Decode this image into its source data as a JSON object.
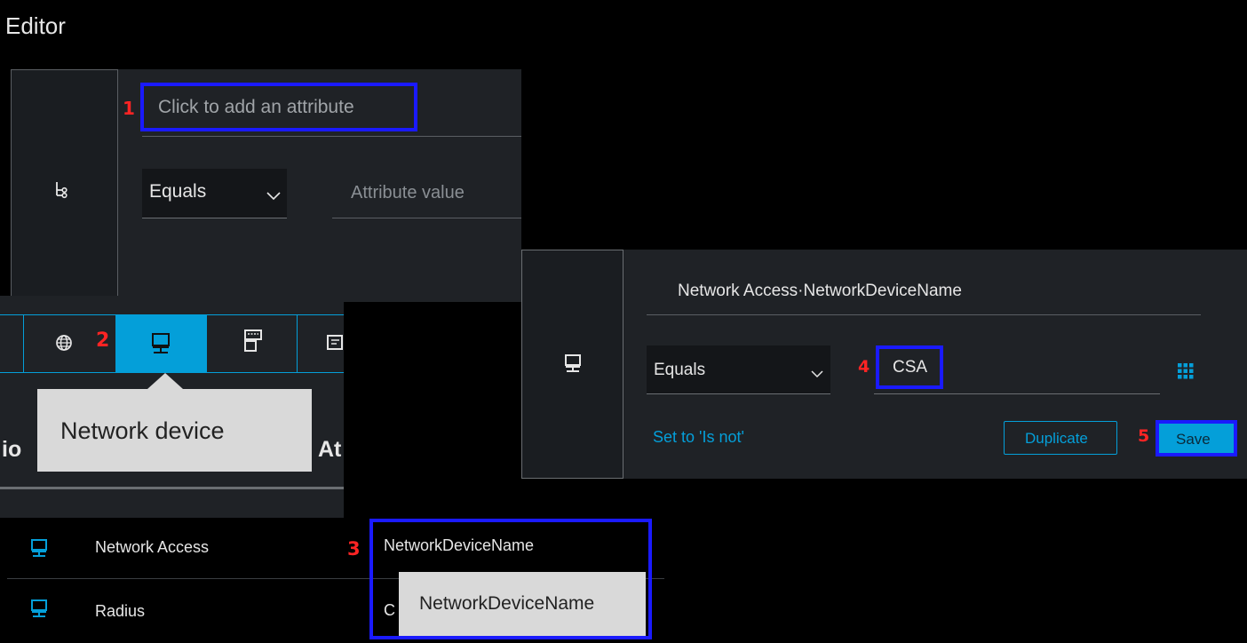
{
  "editor_title": "Editor",
  "colors": {
    "accent": "#049fd9",
    "highlight": "#1a1aff",
    "step": "#ff2424",
    "panel": "#1f2226"
  },
  "steps": {
    "s1": "1",
    "s2": "2",
    "s3": "3",
    "s4": "4",
    "s5": "5"
  },
  "panel1": {
    "attribute_placeholder": "Click to add an attribute",
    "operator": "Equals",
    "value_placeholder": "Attribute value",
    "icon": "condition-tree-icon"
  },
  "toolbar": {
    "icons": [
      "globe-icon",
      "network-device-icon",
      "device-type-icon",
      "device-location-icon"
    ],
    "tooltip": "Network device"
  },
  "table": {
    "header_left": "io",
    "header_right": "At",
    "rows": [
      {
        "dictionary": "Network Access",
        "attribute": "NetworkDeviceName"
      },
      {
        "dictionary": "Radius",
        "attribute": "C"
      }
    ],
    "attribute_tooltip": "NetworkDeviceName"
  },
  "panel2": {
    "attribute": "Network Access·NetworkDeviceName",
    "operator": "Equals",
    "value": "CSA",
    "set_is_not": "Set to 'Is not'",
    "duplicate": "Duplicate",
    "save": "Save"
  }
}
